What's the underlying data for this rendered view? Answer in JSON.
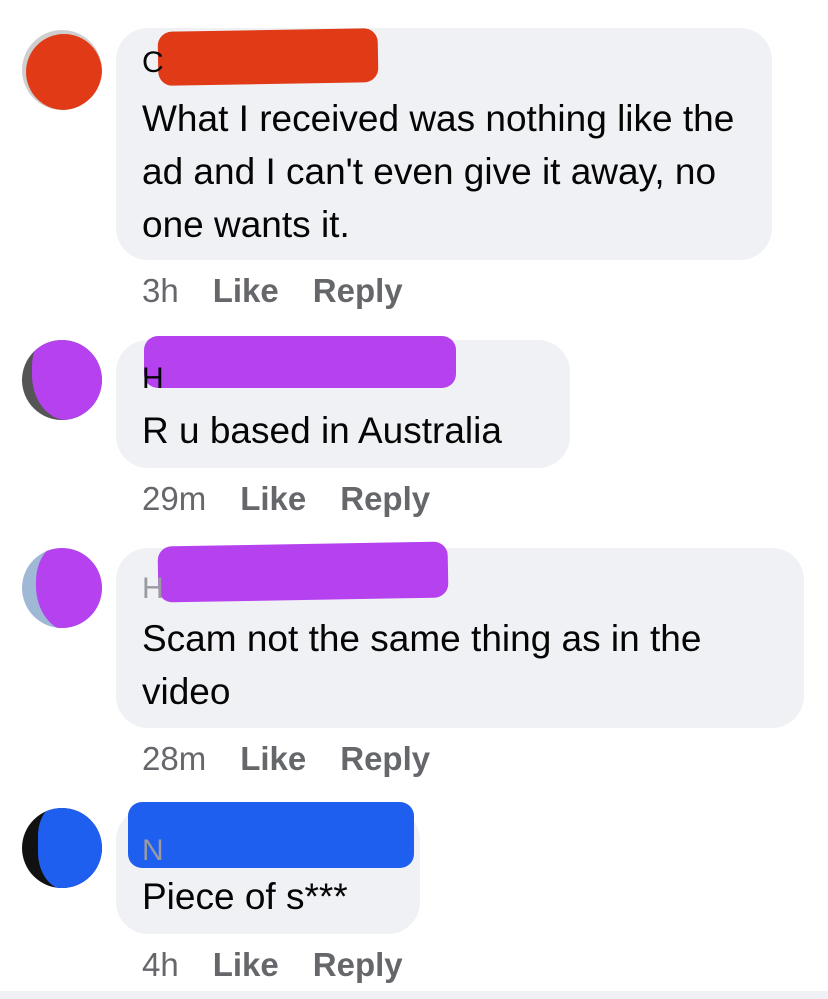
{
  "comments": [
    {
      "name_fragment": "C",
      "redact_color": "#e03b16",
      "text": "What I received was nothing like the ad and I can't even give it away, no one wants it.",
      "time": "3h",
      "like": "Like",
      "reply": "Reply"
    },
    {
      "name_fragment": "H",
      "redact_color": "#b542ee",
      "text": "R u based in Australia",
      "time": "29m",
      "like": "Like",
      "reply": "Reply"
    },
    {
      "name_fragment": "H",
      "redact_color": "#b542ee",
      "text": "Scam not the same thing as in the video",
      "time": "28m",
      "like": "Like",
      "reply": "Reply"
    },
    {
      "name_fragment": "N",
      "redact_color": "#1f5ff0",
      "text": "Piece of s***",
      "time": "4h",
      "like": "Like",
      "reply": "Reply"
    }
  ]
}
